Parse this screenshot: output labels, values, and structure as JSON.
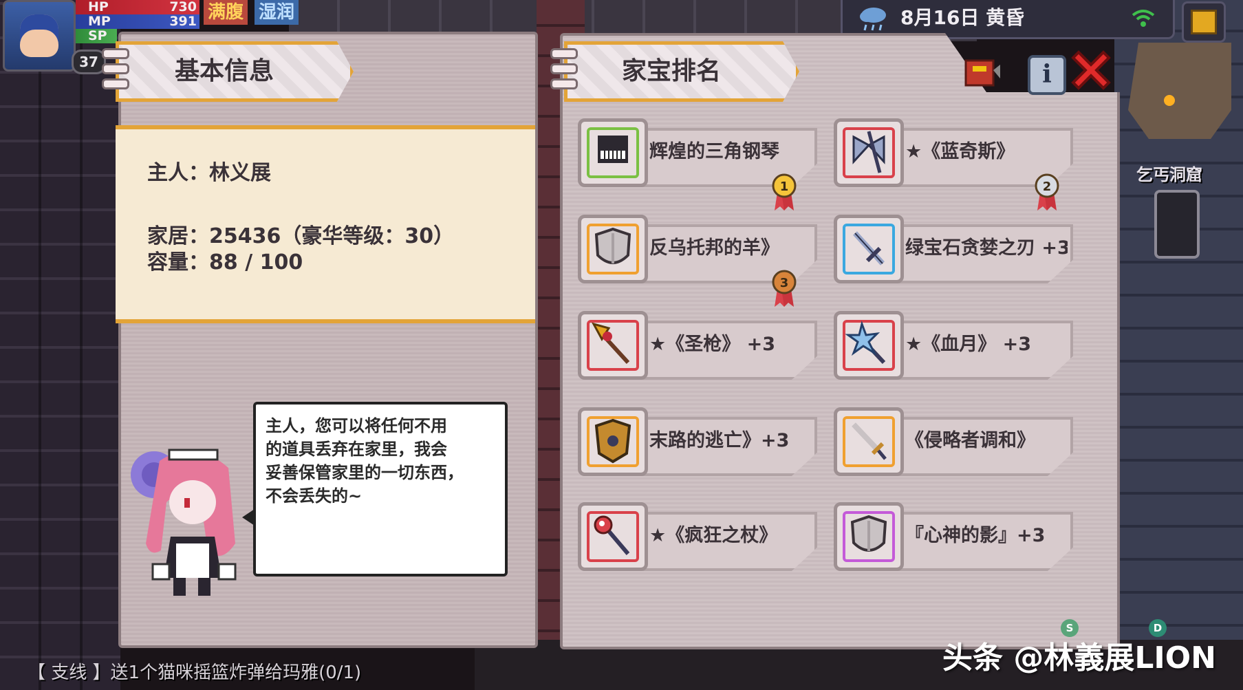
{
  "hud": {
    "level": "37",
    "hp_label": "HP",
    "hp_value": "730",
    "hp_fill": 1.0,
    "mp_label": "MP",
    "mp_value": "391",
    "mp_fill": 1.0,
    "sp_label": "SP",
    "status_full": "满腹",
    "status_wet": "湿润",
    "date": "8月16日 黄昏",
    "location": "乞丐洞窟"
  },
  "basic_info": {
    "title": "基本信息",
    "owner": "主人：林义展",
    "home": "家居：25436（豪华等级：30）",
    "capacity": "容量：88 / 100"
  },
  "dialog": {
    "text": "主人，您可以将任何不用\n的道具丢弃在家里，我会\n妥善保管家里的一切东西，\n不会丢失的~"
  },
  "ranking": {
    "title": "家宝排名",
    "items": [
      {
        "name": "辉煌的三角钢琴",
        "frame_color": "#7bc043",
        "icon": "piano-icon",
        "rank": "1"
      },
      {
        "name": "★《蓝奇斯》",
        "frame_color": "#d9414a",
        "icon": "axe-icon",
        "rank": "2"
      },
      {
        "name": "反乌托邦的羊》",
        "frame_color": "#f0a030",
        "icon": "shield-icon",
        "rank": "3"
      },
      {
        "name": "绿宝石贪婪之刃 +3",
        "frame_color": "#3aa8e0",
        "icon": "sword-icon",
        "rank": ""
      },
      {
        "name": "★《圣枪》 +3",
        "frame_color": "#d9414a",
        "icon": "spear-icon",
        "rank": ""
      },
      {
        "name": "★《血月》 +3",
        "frame_color": "#d9414a",
        "icon": "mace-icon",
        "rank": ""
      },
      {
        "name": "末路的逃亡》+3",
        "frame_color": "#f0a030",
        "icon": "armor-icon",
        "rank": ""
      },
      {
        "name": "《侵略者调和》",
        "frame_color": "#f0a030",
        "icon": "dagger-icon",
        "rank": ""
      },
      {
        "name": "★《疯狂之杖》",
        "frame_color": "#d9414a",
        "icon": "staff-icon",
        "rank": ""
      },
      {
        "name": "『心神的影』+3",
        "frame_color": "#c45ad8",
        "icon": "shield-icon",
        "rank": ""
      }
    ]
  },
  "quest": "【 支线 】送1个猫咪摇篮炸弹给玛雅(0/1)",
  "watermark": "头条 @林義展LION",
  "corner_badges": {
    "s": "S",
    "d": "D"
  }
}
